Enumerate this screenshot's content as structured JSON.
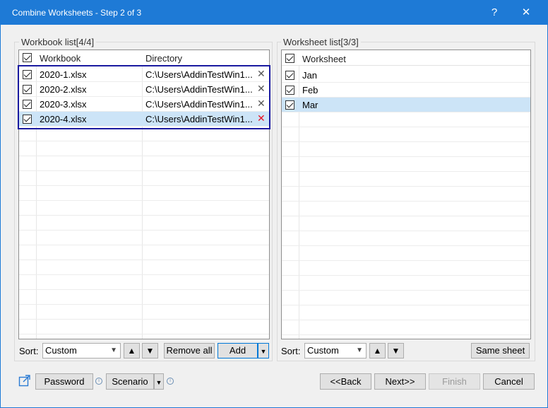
{
  "window": {
    "title": "Combine Worksheets - Step 2 of 3",
    "help": "?",
    "close": "✕"
  },
  "workbook_list": {
    "title": "Workbook list[4/4]",
    "columns": [
      "Workbook",
      "Directory"
    ],
    "rows": [
      {
        "name": "2020-1.xlsx",
        "dir": "C:\\Users\\AddinTestWin1...",
        "checked": true
      },
      {
        "name": "2020-2.xlsx",
        "dir": "C:\\Users\\AddinTestWin1...",
        "checked": true
      },
      {
        "name": "2020-3.xlsx",
        "dir": "C:\\Users\\AddinTestWin1...",
        "checked": true
      },
      {
        "name": "2020-4.xlsx",
        "dir": "C:\\Users\\AddinTestWin1...",
        "checked": true
      }
    ],
    "sort_label": "Sort:",
    "sort_value": "Custom",
    "remove_all": "Remove all",
    "add": "Add"
  },
  "worksheet_list": {
    "title": "Worksheet list[3/3]",
    "column": "Worksheet",
    "rows": [
      {
        "name": "Jan",
        "checked": true
      },
      {
        "name": "Feb",
        "checked": true
      },
      {
        "name": "Mar",
        "checked": true
      }
    ],
    "sort_label": "Sort:",
    "sort_value": "Custom",
    "same_sheet": "Same sheet"
  },
  "footer": {
    "password": "Password",
    "scenario": "Scenario",
    "back": "<<Back",
    "next": "Next>>",
    "finish": "Finish",
    "cancel": "Cancel"
  },
  "colors": {
    "title_bar": "#1e7ad6",
    "selected_row": "#cce4f7",
    "highlight_border": "#1a1aa0",
    "delete_active": "#e81123"
  }
}
